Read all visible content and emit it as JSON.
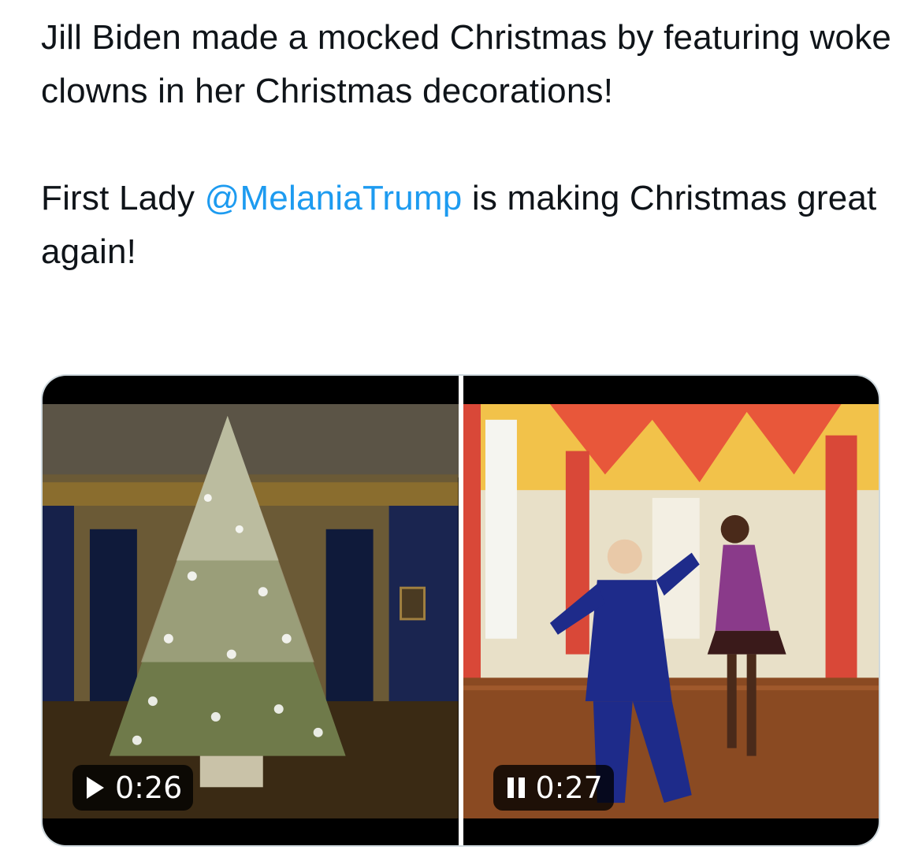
{
  "tweet": {
    "paragraph1": "Jill Biden made a mocked Christmas by featuring woke clowns in her Christmas decorations!",
    "paragraph2_before": "First Lady ",
    "mention": "@MelaniaTrump",
    "paragraph2_after": " is making Christmas great again!"
  },
  "media": [
    {
      "duration": "0:26",
      "state_icon": "play-icon"
    },
    {
      "duration": "0:27",
      "state_icon": "pause-icon"
    }
  ],
  "colors": {
    "text": "#0f1419",
    "mention": "#1d9bf0",
    "card_border": "#cfd9de"
  }
}
